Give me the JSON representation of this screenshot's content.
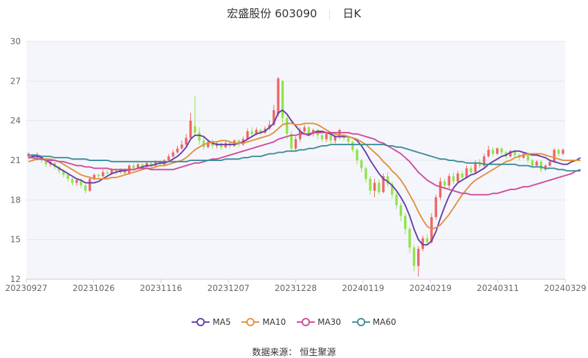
{
  "title": {
    "name": "宏盛股份 603090",
    "period": "日K"
  },
  "source_label": "数据来源：  恒生聚源",
  "chart_data": {
    "type": "candlestick",
    "ylim": [
      12,
      30
    ],
    "y_ticks": [
      12,
      15,
      18,
      21,
      24,
      27,
      30
    ],
    "x_tick_labels": [
      "20230927",
      "20231026",
      "20231116",
      "20231207",
      "20231228",
      "20240119",
      "20240219",
      "20240311",
      "20240329"
    ],
    "grid": "horizontal",
    "legend_position": "bottom",
    "up_color": "#ee6666",
    "down_color": "#91e44a",
    "legend": [
      {
        "name": "MA5",
        "color": "#6a3fa8"
      },
      {
        "name": "MA10",
        "color": "#e39040"
      },
      {
        "name": "MA30",
        "color": "#cf4d9c"
      },
      {
        "name": "MA60",
        "color": "#3f8f9a"
      }
    ],
    "candles": [
      [
        21.3,
        21.5,
        21.6,
        21.1
      ],
      [
        21.4,
        21.2,
        21.5,
        21.0
      ],
      [
        21.2,
        21.4,
        21.6,
        21.0
      ],
      [
        21.3,
        21.0,
        21.4,
        20.8
      ],
      [
        21.0,
        20.7,
        21.1,
        20.5
      ],
      [
        20.7,
        20.9,
        21.0,
        20.5
      ],
      [
        20.8,
        20.5,
        20.9,
        20.3
      ],
      [
        20.5,
        20.2,
        20.6,
        20.0
      ],
      [
        20.2,
        19.9,
        20.3,
        19.7
      ],
      [
        19.9,
        19.6,
        20.0,
        19.4
      ],
      [
        19.6,
        19.3,
        19.7,
        19.1
      ],
      [
        19.3,
        19.5,
        19.6,
        19.1
      ],
      [
        19.5,
        19.1,
        19.6,
        18.9
      ],
      [
        19.1,
        18.7,
        19.2,
        18.5
      ],
      [
        18.7,
        19.6,
        19.8,
        18.6
      ],
      [
        19.6,
        19.9,
        20.0,
        19.5
      ],
      [
        19.9,
        19.8,
        20.0,
        19.6
      ],
      [
        19.8,
        20.1,
        20.3,
        19.7
      ],
      [
        20.1,
        20.0,
        20.3,
        19.8
      ],
      [
        20.0,
        20.3,
        20.4,
        19.9
      ],
      [
        20.3,
        20.1,
        20.4,
        19.9
      ],
      [
        20.1,
        20.3,
        20.4,
        20.0
      ],
      [
        20.3,
        20.0,
        20.4,
        19.9
      ],
      [
        20.0,
        20.6,
        20.7,
        19.9
      ],
      [
        20.6,
        20.4,
        20.8,
        20.3
      ],
      [
        20.4,
        20.7,
        20.8,
        20.3
      ],
      [
        20.7,
        20.5,
        20.8,
        20.4
      ],
      [
        20.5,
        20.8,
        20.9,
        20.4
      ],
      [
        20.8,
        20.6,
        20.9,
        20.5
      ],
      [
        20.6,
        20.9,
        21.0,
        20.5
      ],
      [
        20.9,
        20.7,
        21.0,
        20.6
      ],
      [
        20.7,
        21.0,
        21.1,
        20.6
      ],
      [
        21.0,
        21.3,
        21.5,
        20.9
      ],
      [
        21.3,
        21.6,
        21.8,
        21.2
      ],
      [
        21.6,
        21.9,
        22.1,
        21.5
      ],
      [
        21.9,
        22.2,
        22.5,
        21.8
      ],
      [
        22.2,
        22.7,
        23.0,
        22.0
      ],
      [
        22.7,
        24.0,
        24.6,
        22.5
      ],
      [
        23.6,
        23.1,
        25.9,
        22.8
      ],
      [
        23.1,
        22.5,
        23.5,
        22.2
      ],
      [
        22.5,
        22.0,
        22.8,
        21.8
      ],
      [
        22.0,
        22.4,
        22.6,
        21.9
      ],
      [
        22.4,
        22.1,
        22.6,
        21.9
      ],
      [
        22.1,
        22.3,
        22.4,
        21.9
      ],
      [
        22.3,
        22.0,
        22.4,
        21.8
      ],
      [
        22.0,
        22.3,
        22.5,
        21.9
      ],
      [
        22.3,
        22.1,
        22.4,
        21.9
      ],
      [
        22.1,
        22.5,
        22.6,
        22.0
      ],
      [
        22.5,
        22.2,
        22.6,
        22.0
      ],
      [
        22.2,
        22.6,
        22.8,
        22.1
      ],
      [
        22.6,
        23.2,
        23.4,
        22.5
      ],
      [
        23.2,
        23.0,
        23.5,
        22.8
      ],
      [
        23.0,
        23.3,
        23.5,
        22.9
      ],
      [
        23.3,
        23.1,
        23.4,
        22.9
      ],
      [
        23.1,
        23.4,
        23.6,
        23.0
      ],
      [
        23.4,
        23.7,
        24.0,
        23.3
      ],
      [
        23.7,
        24.8,
        25.2,
        23.6
      ],
      [
        24.5,
        27.2,
        27.3,
        24.3
      ],
      [
        27.0,
        24.2,
        27.1,
        23.8
      ],
      [
        24.2,
        23.0,
        24.4,
        22.6
      ],
      [
        23.0,
        21.9,
        23.2,
        21.6
      ],
      [
        21.9,
        22.6,
        22.8,
        21.7
      ],
      [
        22.6,
        23.2,
        23.5,
        22.4
      ],
      [
        23.2,
        23.5,
        23.7,
        23.0
      ],
      [
        23.5,
        23.0,
        23.6,
        22.8
      ],
      [
        23.0,
        23.3,
        23.4,
        22.8
      ],
      [
        23.3,
        22.9,
        23.4,
        22.6
      ],
      [
        22.9,
        22.6,
        23.0,
        22.4
      ],
      [
        22.6,
        23.0,
        23.1,
        22.4
      ],
      [
        23.0,
        22.5,
        23.1,
        22.3
      ],
      [
        22.5,
        22.8,
        22.9,
        22.3
      ],
      [
        22.8,
        23.3,
        23.4,
        22.6
      ],
      [
        22.9,
        22.7,
        23.0,
        22.5
      ],
      [
        22.7,
        22.4,
        22.8,
        22.2
      ],
      [
        22.4,
        21.8,
        22.5,
        21.6
      ],
      [
        21.8,
        21.0,
        21.9,
        20.7
      ],
      [
        21.0,
        20.4,
        21.1,
        20.1
      ],
      [
        20.4,
        19.6,
        20.5,
        19.3
      ],
      [
        19.6,
        18.7,
        19.8,
        18.4
      ],
      [
        18.7,
        19.3,
        19.6,
        18.2
      ],
      [
        19.3,
        18.6,
        19.5,
        18.4
      ],
      [
        18.6,
        19.8,
        20.0,
        18.5
      ],
      [
        19.8,
        19.2,
        20.1,
        19.0
      ],
      [
        19.2,
        18.4,
        19.4,
        18.1
      ],
      [
        18.4,
        17.6,
        18.6,
        17.3
      ],
      [
        17.6,
        16.8,
        17.8,
        16.4
      ],
      [
        16.8,
        15.8,
        17.0,
        15.4
      ],
      [
        15.8,
        14.4,
        16.0,
        14.0
      ],
      [
        14.4,
        13.0,
        14.6,
        12.6
      ],
      [
        13.0,
        14.3,
        14.5,
        12.2
      ],
      [
        14.3,
        15.1,
        15.3,
        14.1
      ],
      [
        15.1,
        14.8,
        15.4,
        14.6
      ],
      [
        14.8,
        16.7,
        17.0,
        14.7
      ],
      [
        16.7,
        18.2,
        18.4,
        16.5
      ],
      [
        18.2,
        19.4,
        19.7,
        18.0
      ],
      [
        19.4,
        19.1,
        19.6,
        18.8
      ],
      [
        19.1,
        19.8,
        20.0,
        18.9
      ],
      [
        19.8,
        19.4,
        20.1,
        19.2
      ],
      [
        19.4,
        20.0,
        20.2,
        19.3
      ],
      [
        20.0,
        19.7,
        20.2,
        19.5
      ],
      [
        19.7,
        20.4,
        20.6,
        19.6
      ],
      [
        20.4,
        20.1,
        20.6,
        19.9
      ],
      [
        20.1,
        20.8,
        21.0,
        20.0
      ],
      [
        20.8,
        20.6,
        21.1,
        20.4
      ],
      [
        20.6,
        21.3,
        21.5,
        20.5
      ],
      [
        21.3,
        21.8,
        22.1,
        21.2
      ],
      [
        21.8,
        21.5,
        22.0,
        21.3
      ],
      [
        21.5,
        21.9,
        22.0,
        21.4
      ],
      [
        21.9,
        21.6,
        22.0,
        21.4
      ],
      [
        21.6,
        21.3,
        21.7,
        21.1
      ],
      [
        21.3,
        21.7,
        21.8,
        21.2
      ],
      [
        21.7,
        21.4,
        21.8,
        21.2
      ],
      [
        21.4,
        21.2,
        21.5,
        21.0
      ],
      [
        21.2,
        21.5,
        21.6,
        21.1
      ],
      [
        21.5,
        21.0,
        21.6,
        20.8
      ],
      [
        21.0,
        20.6,
        21.1,
        20.4
      ],
      [
        20.6,
        20.9,
        21.0,
        20.5
      ],
      [
        20.9,
        20.3,
        21.0,
        20.1
      ],
      [
        20.3,
        20.6,
        20.7,
        20.2
      ],
      [
        20.6,
        20.9,
        21.0,
        20.5
      ],
      [
        20.9,
        21.8,
        21.9,
        20.8
      ],
      [
        21.8,
        21.5,
        21.9,
        21.3
      ],
      [
        21.5,
        21.8,
        21.9,
        21.4
      ]
    ],
    "series": [
      {
        "name": "MA5",
        "values": [
          21.2,
          21.3,
          21.3,
          21.2,
          21.0,
          20.8,
          20.6,
          20.4,
          20.2,
          20.0,
          19.8,
          19.6,
          19.5,
          19.3,
          19.3,
          19.3,
          19.4,
          19.6,
          19.8,
          20.0,
          20.1,
          20.2,
          20.2,
          20.3,
          20.3,
          20.4,
          20.5,
          20.6,
          20.6,
          20.7,
          20.8,
          20.8,
          20.9,
          21.1,
          21.3,
          21.6,
          22.0,
          22.6,
          22.9,
          22.9,
          22.8,
          22.5,
          22.3,
          22.2,
          22.2,
          22.2,
          22.2,
          22.2,
          22.3,
          22.4,
          22.6,
          22.8,
          23.0,
          23.1,
          23.2,
          23.5,
          23.8,
          24.6,
          24.8,
          24.5,
          24.0,
          23.6,
          23.2,
          23.0,
          22.9,
          23.1,
          23.2,
          23.2,
          23.1,
          23.0,
          22.8,
          22.8,
          22.8,
          22.8,
          22.7,
          22.5,
          22.1,
          21.6,
          21.0,
          20.5,
          20.0,
          19.6,
          19.4,
          19.1,
          18.7,
          18.2,
          17.6,
          16.8,
          15.8,
          15.0,
          14.6,
          14.6,
          14.9,
          15.6,
          16.6,
          17.5,
          18.3,
          18.9,
          19.3,
          19.5,
          19.7,
          19.9,
          20.0,
          20.2,
          20.4,
          20.7,
          20.9,
          21.1,
          21.3,
          21.4,
          21.6,
          21.7,
          21.7,
          21.6,
          21.5,
          21.4,
          21.4,
          21.3,
          21.2,
          21.0,
          20.9,
          20.8,
          20.7,
          20.7,
          20.9,
          21.0,
          21.2
        ]
      },
      {
        "name": "MA10",
        "values": [
          20.9,
          21.0,
          21.1,
          21.1,
          21.1,
          21.1,
          21.0,
          20.9,
          20.7,
          20.5,
          20.3,
          20.1,
          19.9,
          19.8,
          19.7,
          19.6,
          19.6,
          19.6,
          19.6,
          19.7,
          19.7,
          19.8,
          19.9,
          20.0,
          20.1,
          20.2,
          20.3,
          20.4,
          20.4,
          20.5,
          20.6,
          20.6,
          20.7,
          20.8,
          20.9,
          21.0,
          21.2,
          21.5,
          21.8,
          22.0,
          22.2,
          22.3,
          22.4,
          22.4,
          22.5,
          22.5,
          22.4,
          22.3,
          22.3,
          22.3,
          22.4,
          22.5,
          22.6,
          22.7,
          22.8,
          22.9,
          23.1,
          23.4,
          23.7,
          23.8,
          23.8,
          23.7,
          23.7,
          23.8,
          23.8,
          23.8,
          23.7,
          23.5,
          23.3,
          23.1,
          23.0,
          22.9,
          22.9,
          22.8,
          22.7,
          22.6,
          22.4,
          22.2,
          21.9,
          21.6,
          21.3,
          20.9,
          20.6,
          20.2,
          19.9,
          19.5,
          19.0,
          18.4,
          17.8,
          17.1,
          16.5,
          16.0,
          15.8,
          15.9,
          16.1,
          16.5,
          16.9,
          17.4,
          17.9,
          18.4,
          18.8,
          19.2,
          19.5,
          19.7,
          19.9,
          20.1,
          20.3,
          20.5,
          20.7,
          20.9,
          21.0,
          21.2,
          21.3,
          21.4,
          21.5,
          21.5,
          21.5,
          21.5,
          21.4,
          21.3,
          21.2,
          21.1,
          21.0,
          21.0,
          21.0,
          21.0,
          21.0
        ]
      },
      {
        "name": "MA30",
        "values": [
          21.2,
          21.2,
          21.1,
          21.1,
          21.0,
          21.0,
          21.0,
          20.9,
          20.9,
          20.8,
          20.7,
          20.6,
          20.6,
          20.5,
          20.5,
          20.4,
          20.4,
          20.4,
          20.4,
          20.3,
          20.3,
          20.3,
          20.3,
          20.3,
          20.3,
          20.4,
          20.4,
          20.4,
          20.3,
          20.3,
          20.3,
          20.3,
          20.3,
          20.3,
          20.4,
          20.5,
          20.6,
          20.7,
          20.8,
          20.8,
          20.9,
          21.0,
          21.1,
          21.1,
          21.2,
          21.3,
          21.4,
          21.5,
          21.6,
          21.7,
          21.8,
          21.9,
          22.0,
          22.1,
          22.2,
          22.3,
          22.4,
          22.6,
          22.7,
          22.8,
          22.9,
          22.9,
          23.0,
          23.0,
          23.0,
          23.1,
          23.1,
          23.1,
          23.1,
          23.1,
          23.1,
          23.1,
          23.1,
          23.1,
          23.0,
          23.0,
          22.9,
          22.8,
          22.7,
          22.6,
          22.4,
          22.3,
          22.1,
          21.9,
          21.7,
          21.5,
          21.2,
          20.9,
          20.5,
          20.1,
          19.8,
          19.5,
          19.3,
          19.1,
          19.0,
          18.9,
          18.8,
          18.7,
          18.6,
          18.5,
          18.5,
          18.4,
          18.4,
          18.4,
          18.4,
          18.4,
          18.5,
          18.5,
          18.6,
          18.7,
          18.8,
          18.8,
          18.9,
          19.0,
          19.0,
          19.1,
          19.2,
          19.3,
          19.4,
          19.5,
          19.6,
          19.7,
          19.8,
          19.9,
          20.0,
          20.2,
          20.3
        ]
      },
      {
        "name": "MA60",
        "values": [
          21.4,
          21.4,
          21.4,
          21.3,
          21.3,
          21.3,
          21.2,
          21.2,
          21.2,
          21.2,
          21.1,
          21.1,
          21.1,
          21.1,
          21.0,
          21.0,
          21.0,
          21.0,
          21.0,
          20.9,
          20.9,
          20.9,
          20.9,
          20.9,
          20.9,
          20.9,
          20.9,
          20.9,
          20.9,
          20.9,
          20.9,
          20.9,
          20.9,
          20.9,
          20.9,
          20.9,
          20.9,
          21.0,
          21.0,
          21.0,
          21.0,
          21.0,
          21.0,
          21.0,
          21.0,
          21.1,
          21.1,
          21.1,
          21.1,
          21.2,
          21.2,
          21.3,
          21.3,
          21.3,
          21.4,
          21.5,
          21.5,
          21.6,
          21.6,
          21.7,
          21.7,
          21.7,
          21.8,
          21.8,
          21.9,
          21.9,
          22.0,
          22.1,
          22.1,
          22.2,
          22.2,
          22.2,
          22.2,
          22.2,
          22.2,
          22.2,
          22.2,
          22.2,
          22.2,
          22.2,
          22.2,
          22.2,
          22.1,
          22.1,
          22.0,
          22.0,
          21.9,
          21.8,
          21.7,
          21.6,
          21.5,
          21.4,
          21.3,
          21.2,
          21.1,
          21.1,
          21.0,
          21.0,
          20.9,
          20.9,
          20.8,
          20.8,
          20.8,
          20.8,
          20.7,
          20.7,
          20.7,
          20.7,
          20.7,
          20.7,
          20.7,
          20.7,
          20.6,
          20.6,
          20.6,
          20.5,
          20.5,
          20.5,
          20.4,
          20.4,
          20.4,
          20.3,
          20.3,
          20.2,
          20.2,
          20.2,
          20.2
        ]
      }
    ]
  }
}
